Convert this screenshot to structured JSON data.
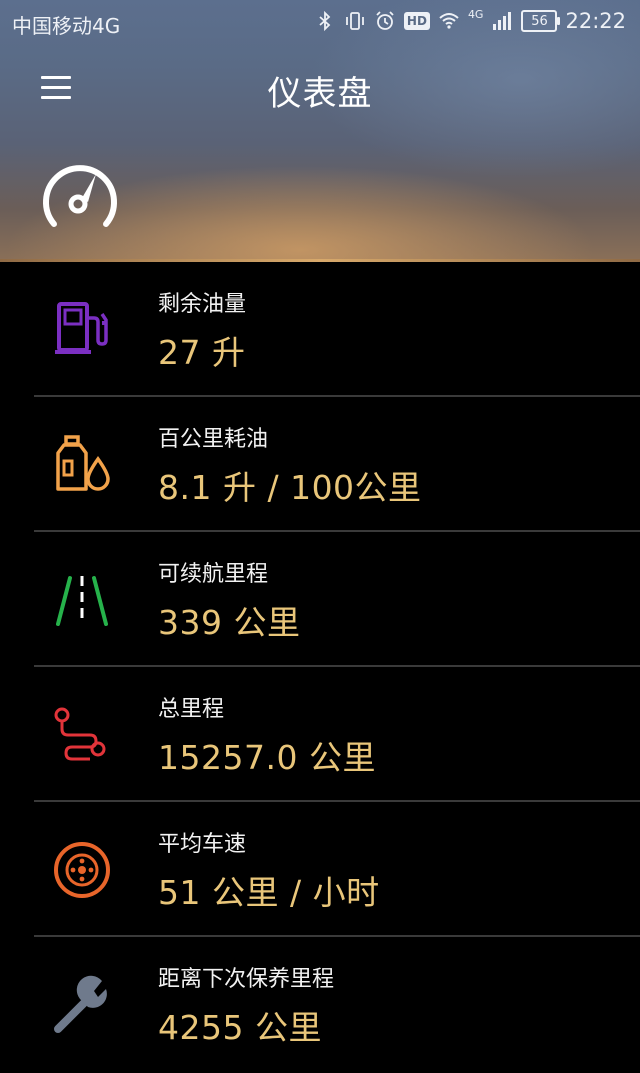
{
  "status_bar": {
    "carrier": "中国移动4G",
    "hd": "HD",
    "network": "4G",
    "battery": "56",
    "time": "22:22"
  },
  "header": {
    "title": "仪表盘"
  },
  "items": [
    {
      "label": "剩余油量",
      "value": "27 升",
      "icon": "fuel-pump-icon",
      "color": "#7b2fc2"
    },
    {
      "label": "百公里耗油",
      "value": "8.1 升 / 100公里",
      "icon": "oil-can-icon",
      "color": "#f2a24a"
    },
    {
      "label": "可续航里程",
      "value": "339 公里",
      "icon": "road-icon",
      "color": "#26b24b"
    },
    {
      "label": "总里程",
      "value": "15257.0 公里",
      "icon": "route-icon",
      "color": "#e2343a"
    },
    {
      "label": "平均车速",
      "value": "51 公里 / 小时",
      "icon": "wheel-icon",
      "color": "#e8652a"
    },
    {
      "label": "距离下次保养里程",
      "value": "4255 公里",
      "icon": "wrench-icon",
      "color": "#6f7a8c"
    }
  ],
  "colors": {
    "value_text": "#e9c67a",
    "background": "#000000"
  }
}
